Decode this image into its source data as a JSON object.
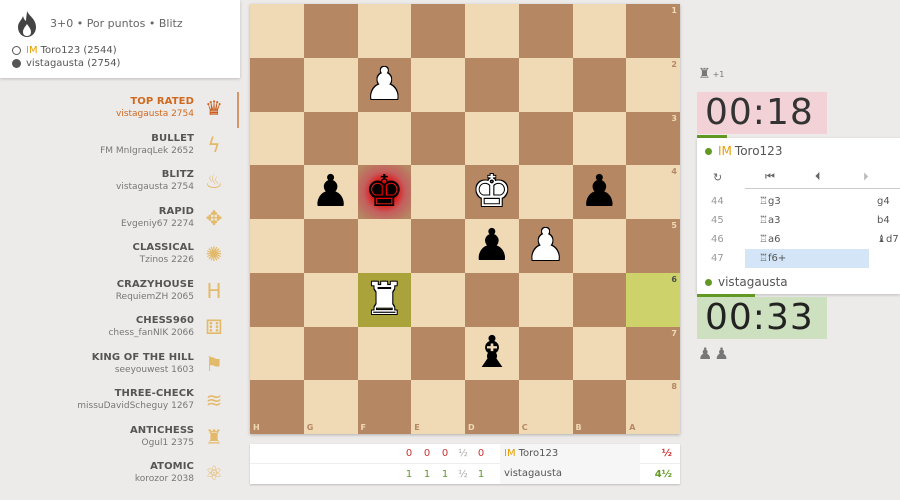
{
  "game_info": {
    "icon": "flame-icon",
    "setup": "3+0 • Por puntos • Blitz",
    "white_player": {
      "title": "IM",
      "name": "Toro123 (2544)"
    },
    "black_player": {
      "name": "vistagausta (2754)"
    }
  },
  "leaderboard": [
    {
      "name": "TOP RATED",
      "leader": "vistagausta 2754",
      "icon": "crown-icon",
      "glyph": "♛",
      "active": true
    },
    {
      "name": "BULLET",
      "leader": "FM MnIgraqLek 2652",
      "icon": "bullet-icon",
      "glyph": "ϟ"
    },
    {
      "name": "BLITZ",
      "leader": "vistagausta 2754",
      "icon": "flame-icon",
      "glyph": "♨"
    },
    {
      "name": "RAPID",
      "leader": "Evgeniy67 2274",
      "icon": "rabbit-icon",
      "glyph": "✥"
    },
    {
      "name": "CLASSICAL",
      "leader": "Tzinos 2226",
      "icon": "turtle-icon",
      "glyph": "✺"
    },
    {
      "name": "CRAZYHOUSE",
      "leader": "RequiemZH 2065",
      "icon": "crazyhouse-icon",
      "glyph": "H"
    },
    {
      "name": "CHESS960",
      "leader": "chess_fanNIK 2066",
      "icon": "dice-icon",
      "glyph": "⚅"
    },
    {
      "name": "KING OF THE HILL",
      "leader": "seeyouwest 1603",
      "icon": "flag-icon",
      "glyph": "⚑"
    },
    {
      "name": "THREE-CHECK",
      "leader": "missuDavidScheguy 1267",
      "icon": "three-check-icon",
      "glyph": "≋"
    },
    {
      "name": "ANTICHESS",
      "leader": "Ogul1 2375",
      "icon": "antichess-icon",
      "glyph": "♜"
    },
    {
      "name": "ATOMIC",
      "leader": "korozor 2038",
      "icon": "atom-icon",
      "glyph": "⚛"
    }
  ],
  "board": {
    "orientation": "black",
    "files": [
      "H",
      "G",
      "F",
      "E",
      "D",
      "C",
      "B",
      "A"
    ],
    "ranks": [
      "1",
      "2",
      "3",
      "4",
      "5",
      "6",
      "7",
      "8"
    ],
    "pieces": [
      {
        "square": "f2",
        "piece": "pawn",
        "color": "white"
      },
      {
        "square": "g4",
        "piece": "pawn",
        "color": "black"
      },
      {
        "square": "f4",
        "piece": "king",
        "color": "black",
        "in_check": true
      },
      {
        "square": "d4",
        "piece": "king",
        "color": "white"
      },
      {
        "square": "b4",
        "piece": "pawn",
        "color": "black"
      },
      {
        "square": "d5",
        "piece": "pawn",
        "color": "black"
      },
      {
        "square": "c5",
        "piece": "pawn",
        "color": "white"
      },
      {
        "square": "f6",
        "piece": "rook",
        "color": "white"
      },
      {
        "square": "d7",
        "piece": "bishop",
        "color": "black"
      }
    ],
    "last_move": [
      "a6",
      "f6"
    ]
  },
  "crosstable": {
    "rows": [
      {
        "scores": [
          "0",
          "0",
          "0",
          "½",
          "0"
        ],
        "title": "IM",
        "name": "Toro123",
        "total": "½"
      },
      {
        "scores": [
          "1",
          "1",
          "1",
          "½",
          "1"
        ],
        "title": "",
        "name": "vistagausta",
        "total": "4½"
      }
    ]
  },
  "right_panel": {
    "material_diff": "+1",
    "top_clock": "00:18",
    "top_player": {
      "title": "IM",
      "name": "Toro123"
    },
    "bottom_clock": "00:33",
    "bottom_player": {
      "name": "vistagausta"
    },
    "controls": {
      "flip": "↻",
      "first": "⏮",
      "prev": "⏴",
      "next": "⏵"
    },
    "moves": [
      {
        "num": "44",
        "white": "♖g3",
        "black": "g4"
      },
      {
        "num": "45",
        "white": "♖a3",
        "black": "b4"
      },
      {
        "num": "46",
        "white": "♖a6",
        "black": "♝d7"
      },
      {
        "num": "47",
        "white": "♖f6+",
        "black": "",
        "current": true
      }
    ],
    "captured": "♟♟"
  }
}
